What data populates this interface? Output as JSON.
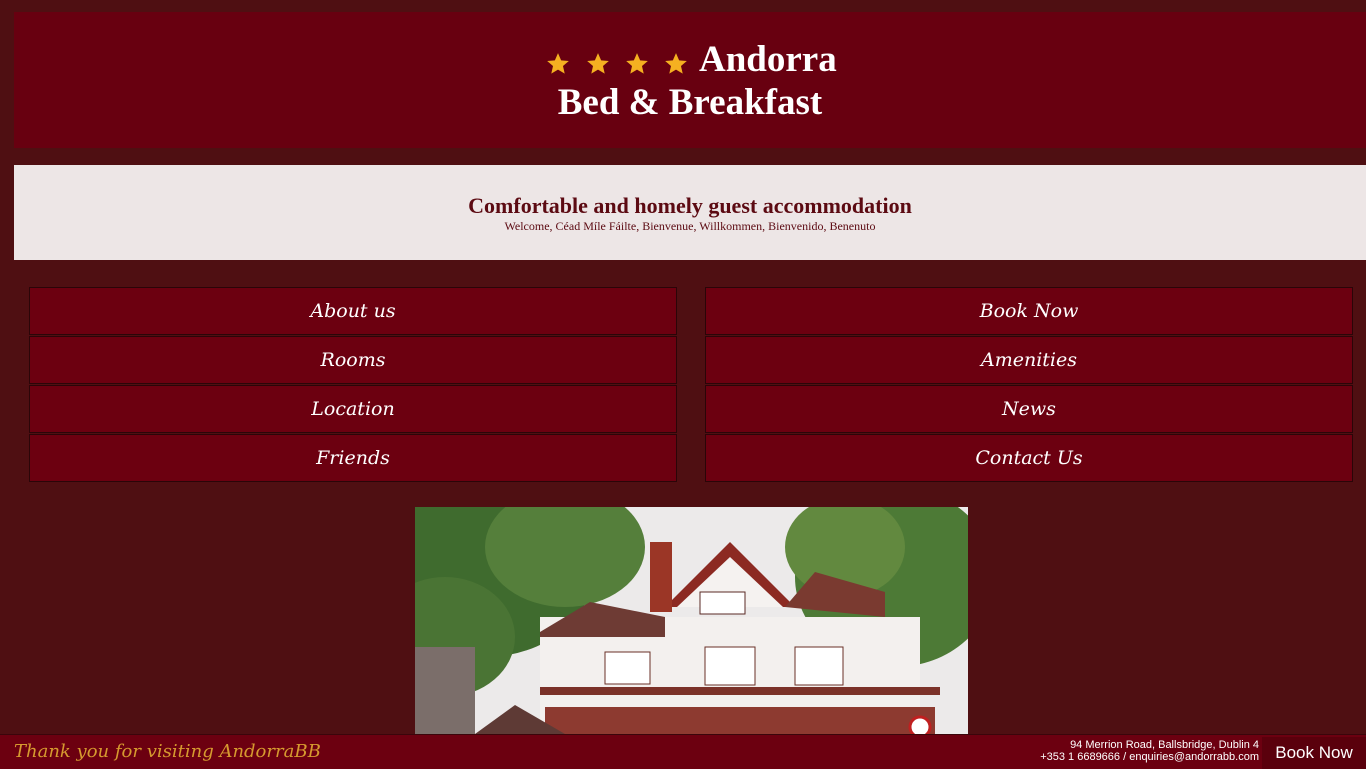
{
  "header": {
    "star_icon": "star-icon",
    "star_count": 4,
    "star_color": "#f5b021",
    "title_line1": "Andorra",
    "title_line2": "Bed & Breakfast",
    "background": "#680010"
  },
  "tagline": {
    "title": "Comfortable and homely guest accommodation",
    "subtitle": "Welcome, Céad Míle Fáilte, Bienvenue, Willkommen, Bienvenido, Benenuto"
  },
  "nav": {
    "left": [
      {
        "label": "About us"
      },
      {
        "label": "Rooms"
      },
      {
        "label": "Location"
      },
      {
        "label": "Friends"
      }
    ],
    "right": [
      {
        "label": "Book Now"
      },
      {
        "label": "Amenities"
      },
      {
        "label": "News"
      },
      {
        "label": "Contact Us"
      }
    ]
  },
  "footer": {
    "thanks": "Thank you for visiting AndorraBB",
    "address_line1": "94 Merrion Road, Ballsbridge, Dublin 4",
    "address_line2": "+353 1 6689666 / enquiries@andorrabb.com",
    "book_label": "Book Now"
  },
  "colors": {
    "page_bg": "#4f0f12",
    "accent": "#6c0010",
    "footer_text": "#d69a2f"
  }
}
